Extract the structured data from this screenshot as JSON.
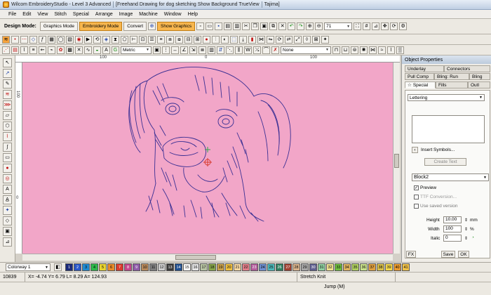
{
  "window": {
    "title_app": "Wilcom EmbroideryStudio - Level 3 Advanced",
    "title_doc": "[Freehand Drawing for dog sketching  Show Background TrueView",
    "title_machine": "Tajima]"
  },
  "menu": [
    "File",
    "Edit",
    "View",
    "Stitch",
    "Special",
    "Arrange",
    "Image",
    "Machine",
    "Window",
    "Help"
  ],
  "toolbar": {
    "design_mode_label": "Design Mode:",
    "graphics_mode": "Graphics Mode",
    "embroidery_mode": "Embroidery Mode",
    "convert": "Convert",
    "show_graphics": "Show Graphics",
    "zoom_value": "71",
    "units": "Metric",
    "fill_none": "None"
  },
  "rulers": {
    "top": [
      "100",
      "0",
      "100"
    ],
    "left": [
      "100",
      "0"
    ]
  },
  "props": {
    "title": "Object Properties",
    "tabs_row1": [
      "Underlay",
      "Connectors"
    ],
    "tabs_row2": [
      "Pull Comp",
      "Bling: Run",
      "Bling"
    ],
    "tabs_row3": [
      "Special",
      "Fills",
      "Outl"
    ],
    "lettering": "Lettering",
    "insert_symbols": "Insert Symbols...",
    "create_text": "Create Text",
    "font": "Block2",
    "preview": "Preview",
    "ttf_conversion": "TTF Conversion...",
    "use_saved_version": "Use saved version",
    "height_label": "Height",
    "height_value": "10.00",
    "height_unit": "mm",
    "width_label": "Width",
    "width_value": "100",
    "width_unit": "%",
    "italic_label": "Italic",
    "italic_value": "0",
    "fx": "FX",
    "save": "Save",
    "ok": "OK"
  },
  "colorbar": {
    "colorway": "Colorway 1",
    "swatches": [
      {
        "n": "1",
        "c": "#1b2a7a"
      },
      {
        "n": "2",
        "c": "#2956c7"
      },
      {
        "n": "3",
        "c": "#1f8ad1"
      },
      {
        "n": "4",
        "c": "#2fb84a"
      },
      {
        "n": "5",
        "c": "#e8d331"
      },
      {
        "n": "6",
        "c": "#e98b2b"
      },
      {
        "n": "7",
        "c": "#d93a2e"
      },
      {
        "n": "8",
        "c": "#c4468c"
      },
      {
        "n": "9",
        "c": "#8f5ca8"
      },
      {
        "n": "10",
        "c": "#b98a5c"
      },
      {
        "n": "11",
        "c": "#7f7f7f"
      },
      {
        "n": "12",
        "c": "#cfcfcf"
      },
      {
        "n": "13",
        "c": "#3a3a3a"
      },
      {
        "n": "14",
        "c": "#1f4f8f"
      },
      {
        "n": "15",
        "c": "#ffffff"
      },
      {
        "n": "16",
        "c": "#e5e5e5"
      },
      {
        "n": "17",
        "c": "#b7c3a2"
      },
      {
        "n": "18",
        "c": "#88a64c"
      },
      {
        "n": "19",
        "c": "#c9a04c"
      },
      {
        "n": "20",
        "c": "#f0c040"
      },
      {
        "n": "21",
        "c": "#f6d7a1"
      },
      {
        "n": "22",
        "c": "#e37f8a"
      },
      {
        "n": "23",
        "c": "#b35b9b"
      },
      {
        "n": "24",
        "c": "#6f8fcf"
      },
      {
        "n": "25",
        "c": "#4cb8b8"
      },
      {
        "n": "26",
        "c": "#2f7f5f"
      },
      {
        "n": "27",
        "c": "#9f3f2f"
      },
      {
        "n": "28",
        "c": "#d9b38c"
      },
      {
        "n": "29",
        "c": "#a7a7a7"
      },
      {
        "n": "30",
        "c": "#5f5f8f"
      },
      {
        "n": "31",
        "c": "#8fcfa0"
      },
      {
        "n": "32",
        "c": "#efe08f"
      },
      {
        "n": "33",
        "c": "#6fbf3f"
      },
      {
        "n": "34",
        "c": "#dfb35f"
      },
      {
        "n": "35",
        "c": "#b0d060"
      },
      {
        "n": "36",
        "c": "#c8e08a"
      },
      {
        "n": "37",
        "c": "#e0a040"
      },
      {
        "n": "38",
        "c": "#d9c04a"
      },
      {
        "n": "39",
        "c": "#f3d84c"
      },
      {
        "n": "40",
        "c": "#e99a2f"
      },
      {
        "n": "41",
        "c": "#f0c24a"
      }
    ]
  },
  "status": {
    "stitches": "10839",
    "coords": "X=  -4.74 Y=  6.79 L=  8.29 A= 124.93",
    "stitch_type": "Stretch Knit",
    "function": "Jump (M)"
  },
  "colors": {
    "canvas": "#f2a6c8",
    "sketch": "#3a2f93",
    "mode_active": "#f7b64e"
  }
}
